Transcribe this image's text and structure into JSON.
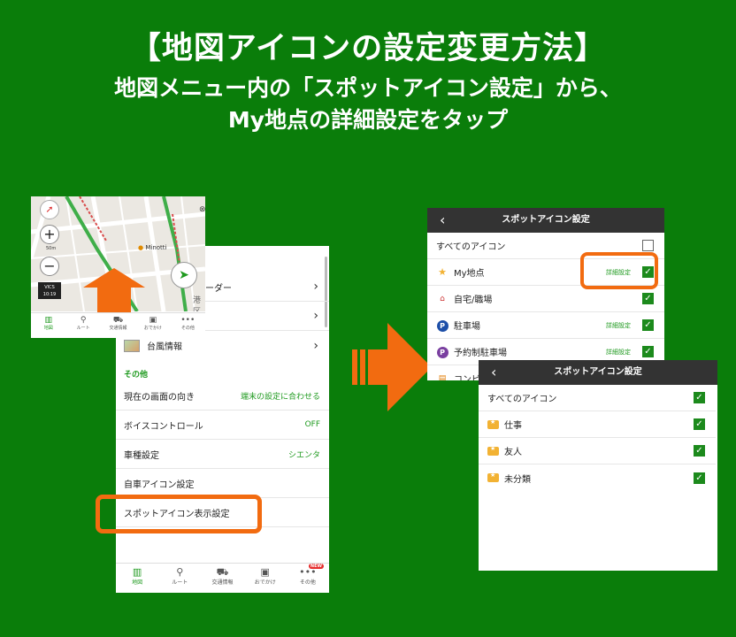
{
  "title": {
    "line1": "【地図アイコンの設定変更方法】",
    "line2": "地図メニュー内の「スポットアイコン設定」から、",
    "line3": "My地点の詳細設定をタップ"
  },
  "map_screen": {
    "poi_label": "Minotti",
    "scale": "50m",
    "vics": "VICS",
    "clock": "10:19",
    "place": "港区",
    "nav": [
      "地図",
      "ルート",
      "交通情報",
      "おでかけ",
      "その他"
    ]
  },
  "menu_screen": {
    "rows_top": [
      {
        "label": "ーダー"
      },
      {
        "label": ""
      },
      {
        "label": "台風情報"
      }
    ],
    "section": "その他",
    "rows": [
      {
        "label": "現在の画面の向き",
        "value": "端末の設定に合わせる"
      },
      {
        "label": "ボイスコントロール",
        "value": "OFF"
      },
      {
        "label": "車種設定",
        "value": "シエンタ"
      },
      {
        "label": "自車アイコン設定",
        "value": ""
      },
      {
        "label": "スポットアイコン表示設定",
        "value": ""
      }
    ],
    "nav": [
      "地図",
      "ルート",
      "交通情報",
      "おでかけ",
      "その他"
    ],
    "new_badge": "NEW"
  },
  "spot_settings": {
    "header": "スポットアイコン設定",
    "detail_label": "詳細設定",
    "rows": [
      {
        "label": "すべてのアイコン",
        "checked": false,
        "detail": false
      },
      {
        "label": "My地点",
        "checked": true,
        "detail": true
      },
      {
        "label": "自宅/職場",
        "checked": true,
        "detail": false
      },
      {
        "label": "駐車場",
        "checked": true,
        "detail": true
      },
      {
        "label": "予約制駐車場",
        "checked": true,
        "detail": true
      },
      {
        "label": "コンビ",
        "checked": true,
        "detail": false
      }
    ]
  },
  "spot_detail": {
    "header": "スポットアイコン設定",
    "rows": [
      {
        "label": "すべてのアイコン",
        "checked": true
      },
      {
        "label": "仕事",
        "checked": true
      },
      {
        "label": "友人",
        "checked": true
      },
      {
        "label": "未分類",
        "checked": true
      }
    ]
  },
  "colors": {
    "background": "#0a7d0a",
    "accent_green": "#1f9a1f",
    "highlight_orange": "#f26b10",
    "header_dark": "#333333"
  }
}
